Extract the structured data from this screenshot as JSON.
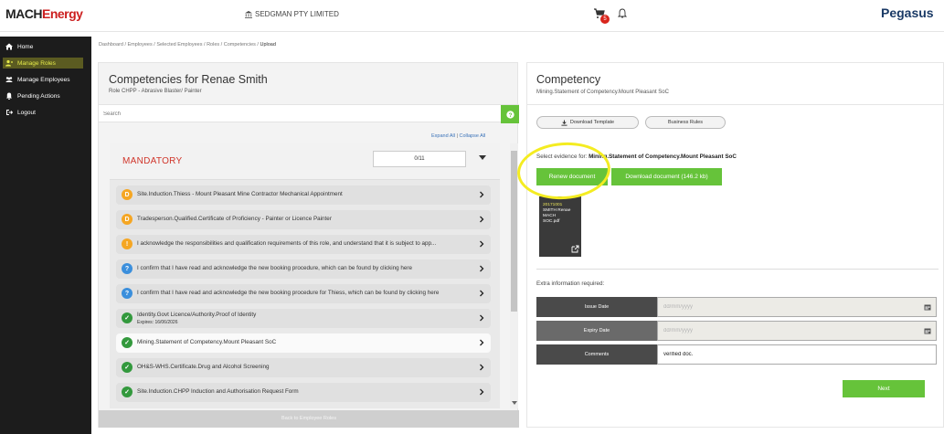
{
  "header": {
    "logo_left_a": "MACH",
    "logo_left_b": "Energy",
    "company": "SEDGMAN PTY LIMITED",
    "cart_count": "5",
    "logo_right": "Pegasus"
  },
  "sidebar": {
    "items": [
      {
        "label": "Home",
        "icon": "home-icon"
      },
      {
        "label": "Manage Roles",
        "icon": "users-icon",
        "active": true
      },
      {
        "label": "Manage Employees",
        "icon": "employees-icon"
      },
      {
        "label": "Pending Actions",
        "icon": "bell-icon"
      },
      {
        "label": "Logout",
        "icon": "logout-icon"
      }
    ]
  },
  "breadcrumb": {
    "items": [
      "Dashboard",
      "Employees",
      "Selected Employees",
      "Roles",
      "Competencies"
    ],
    "current": "Upload"
  },
  "left": {
    "title": "Competencies for Renae Smith",
    "role": "Role CHPP - Abrasive Blaster/ Painter",
    "search_placeholder": "Search",
    "expand_all": "Expand All",
    "collapse_all": "Collapse All",
    "mandatory_label": "MANDATORY",
    "count": "0/11",
    "rows": [
      {
        "text": "Site.Induction.Thiess - Mount Pleasant Mine Contractor Mechanical Appointment",
        "status": "orange",
        "glyph": "D"
      },
      {
        "text": "Tradesperson.Qualified.Certificate of Proficiency - Painter or Licence Painter",
        "status": "orange",
        "glyph": "D"
      },
      {
        "text": "I acknowledge the responsibilities and qualification requirements of this role, and understand that it is subject to app...",
        "status": "orange",
        "glyph": "!"
      },
      {
        "text": "I confirm that I have read and acknowledge the new booking procedure, which can be found by clicking here",
        "status": "blue",
        "glyph": "?"
      },
      {
        "text": "I confirm that I have read and acknowledge the new booking procedure for Thiess, which can be found by clicking here",
        "status": "blue",
        "glyph": "?"
      },
      {
        "text": "Identity.Govt Licence/Authority.Proof of Identity",
        "sub": "Expires: 16/06/2026",
        "status": "green",
        "glyph": "✓"
      },
      {
        "text": "Mining.Statement of Competency.Mount Pleasant SoC",
        "status": "green",
        "glyph": "✓",
        "selected": true
      },
      {
        "text": "OH&S-WHS.Certificate.Drug and Alcohol Screening",
        "status": "green",
        "glyph": "✓"
      },
      {
        "text": "Site.Induction.CHPP Induction and Authorisation Request Form",
        "status": "green",
        "glyph": "✓"
      }
    ],
    "back_button": "Back to Employee Roles"
  },
  "right": {
    "title": "Competency",
    "subtitle": "Mining.Statement of Competency.Mount Pleasant SoC",
    "download_template": "Download Template",
    "business_rules": "Business Rules",
    "evidence_prefix": "Select evidence for: ",
    "evidence_name": "Mining.Statement of Competency.Mount Pleasant SoC",
    "renew_button": "Renew document",
    "download_doc_button": "Download document (146.2 kb)",
    "doc_lines": [
      "20171001",
      "SMITH Renae",
      "MACH",
      "SOC.pdf"
    ],
    "extra_label": "Extra information required:",
    "fields": [
      {
        "label": "Issue Date",
        "placeholder": "dd/mm/yyyy",
        "value": ""
      },
      {
        "label": "Expiry Date",
        "placeholder": "dd/mm/yyyy",
        "value": ""
      },
      {
        "label": "Comments",
        "placeholder": "",
        "value": "verified doc."
      }
    ],
    "next_button": "Next"
  },
  "colors": {
    "accent_green": "#66c33a",
    "brand_red": "#cc1f1f",
    "highlight_yellow": "#f4ec21",
    "sidebar_bg": "#1c1c1c"
  }
}
